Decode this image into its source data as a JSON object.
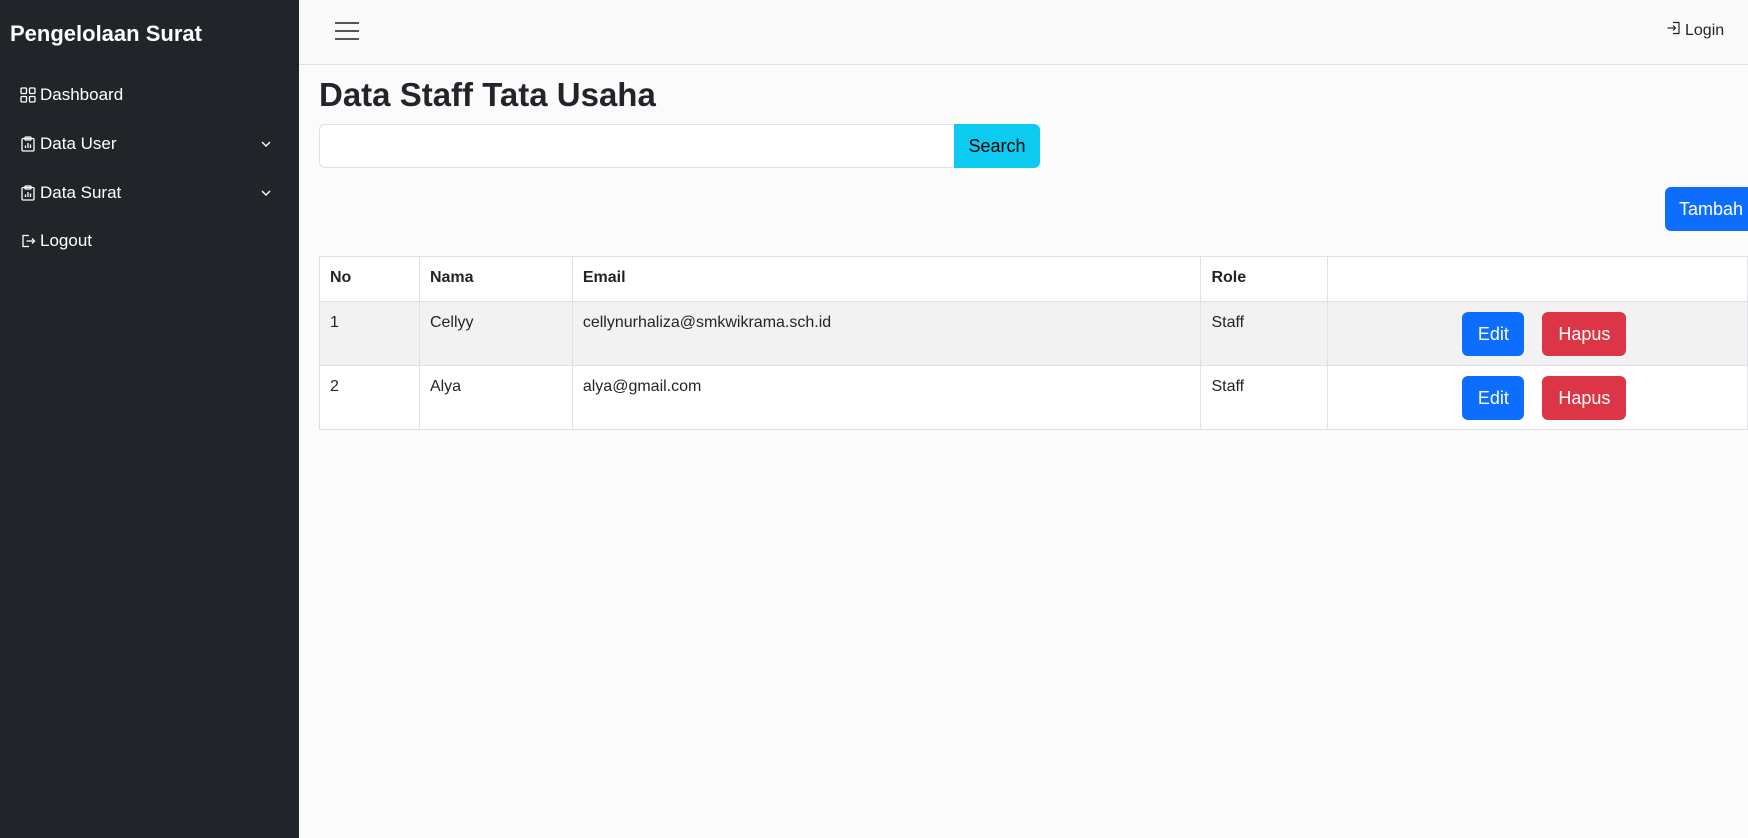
{
  "sidebar": {
    "brand": "Pengelolaan Surat",
    "items": [
      {
        "label": "Dashboard",
        "icon": "grid-icon"
      },
      {
        "label": "Data User",
        "icon": "clipboard-icon",
        "has_submenu": true
      },
      {
        "label": "Data Surat",
        "icon": "clipboard-icon",
        "has_submenu": true
      },
      {
        "label": "Logout",
        "icon": "logout-icon"
      }
    ]
  },
  "topbar": {
    "menu_icon": "hamburger-icon",
    "login_label": "Login",
    "login_icon": "login-icon"
  },
  "main": {
    "title": "Data Staff Tata Usaha",
    "search": {
      "value": "",
      "placeholder": "",
      "button_label": "Search"
    },
    "add_button_label": "Tambah",
    "table": {
      "columns": [
        "No",
        "Nama",
        "Email",
        "Role",
        ""
      ],
      "rows": [
        {
          "no": "1",
          "nama": "Cellyy",
          "email": "cellynurhaliza@smkwikrama.sch.id",
          "role": "Staff",
          "edit_label": "Edit",
          "delete_label": "Hapus"
        },
        {
          "no": "2",
          "nama": "Alya",
          "email": "alya@gmail.com",
          "role": "Staff",
          "edit_label": "Edit",
          "delete_label": "Hapus"
        }
      ]
    }
  },
  "colors": {
    "sidebar_bg": "#212529",
    "primary": "#0d6efd",
    "danger": "#dc3545",
    "info": "#0dcaf0"
  }
}
